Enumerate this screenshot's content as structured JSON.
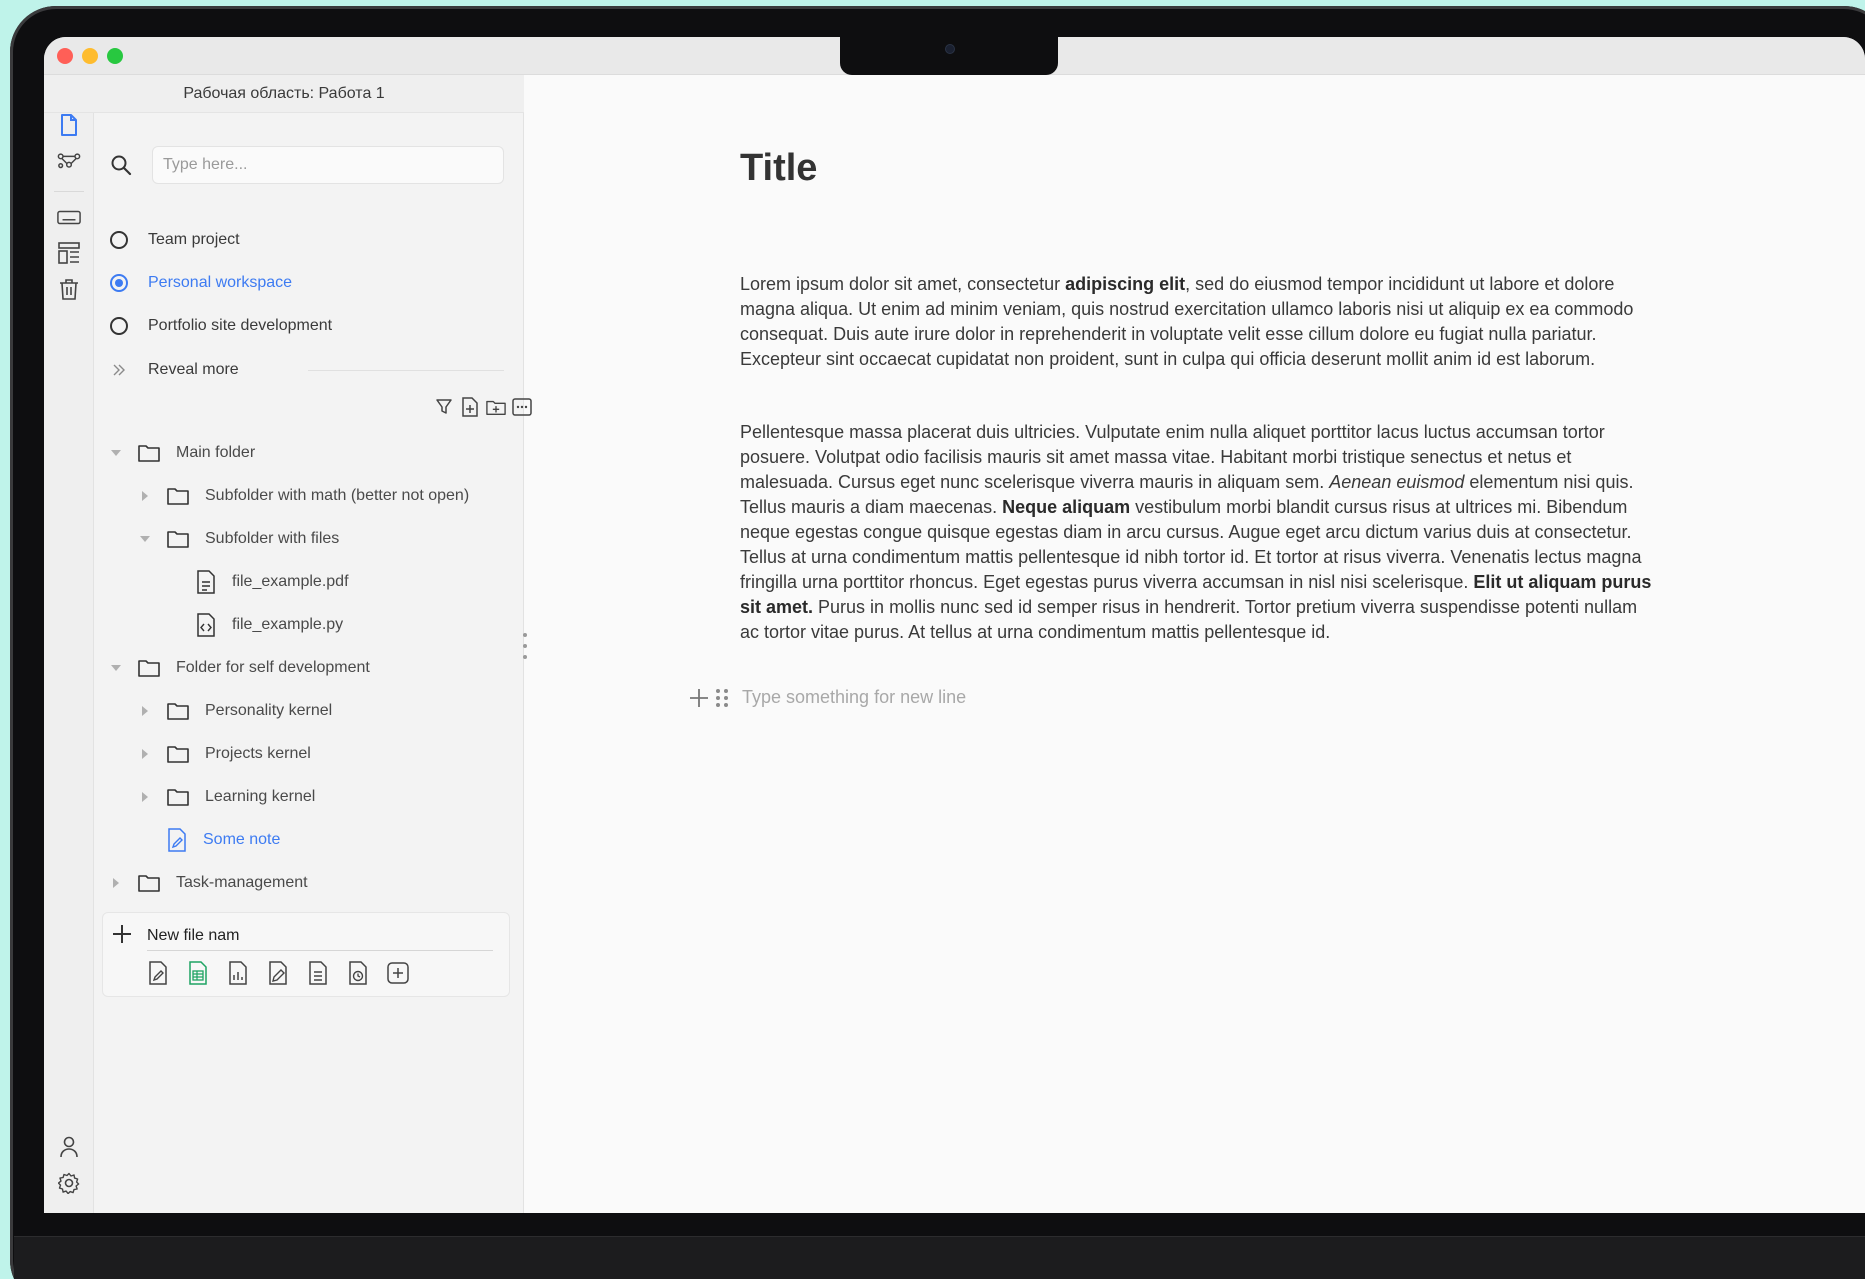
{
  "workspace": {
    "title": "Рабочая область: Работа 1"
  },
  "search": {
    "placeholder": "Type here..."
  },
  "workspaces": [
    {
      "label": "Team project",
      "selected": false
    },
    {
      "label": "Personal workspace",
      "selected": true
    },
    {
      "label": "Portfolio site development",
      "selected": false
    }
  ],
  "reveal_more": "Reveal more",
  "tree": {
    "main_folder": "Main folder",
    "sub_math": "Subfolder with math (better not open)",
    "sub_files": "Subfolder with files",
    "file_pdf": "file_example.pdf",
    "file_py": "file_example.py",
    "self_dev": "Folder for self development",
    "personality": "Personality kernel",
    "projects": "Projects kernel",
    "learning": "Learning kernel",
    "note": "Some note",
    "task_mgmt": "Task-management"
  },
  "new_file": {
    "value": "New file nam"
  },
  "editor": {
    "title": "Title",
    "p1": [
      {
        "t": "Lorem ipsum dolor sit amet, consectetur ",
        "s": "normal"
      },
      {
        "t": "adipiscing elit",
        "s": "bold"
      },
      {
        "t": ", sed do eiusmod tempor incididunt ut labore et dolore magna aliqua. Ut enim ad minim veniam, quis nostrud exercitation ullamco laboris nisi ut aliquip ex ea commodo consequat. Duis aute irure dolor in reprehenderit in voluptate velit esse cillum dolore eu fugiat nulla pariatur. Excepteur sint occaecat cupidatat non proident, sunt in culpa qui officia deserunt mollit anim id est laborum.",
        "s": "normal"
      }
    ],
    "p2": [
      {
        "t": "Pellentesque massa placerat duis ultricies. Vulputate enim nulla aliquet porttitor lacus luctus accumsan tortor posuere. Volutpat odio facilisis mauris sit amet massa vitae. Habitant morbi tristique senectus et netus et malesuada. Cursus eget nunc scelerisque viverra mauris in aliquam sem. ",
        "s": "normal"
      },
      {
        "t": "Aenean euismod",
        "s": "italic"
      },
      {
        "t": " elementum nisi quis. Tellus mauris a diam maecenas. ",
        "s": "normal"
      },
      {
        "t": "Neque aliquam",
        "s": "bold"
      },
      {
        "t": " vestibulum morbi blandit cursus risus at ultrices mi. Bibendum neque egestas congue quisque egestas diam in arcu cursus. Augue eget arcu dictum varius duis at consectetur. Tellus at urna condimentum mattis pellentesque id nibh tortor id. Et tortor at risus viverra. Venenatis lectus magna fringilla urna porttitor rhoncus. Eget egestas purus viverra accumsan in nisl nisi scelerisque. ",
        "s": "normal"
      },
      {
        "t": "Elit ut aliquam purus sit amet.",
        "s": "bold"
      },
      {
        "t": " Purus in mollis nunc sed id semper risus in hendrerit. Tortor pretium viverra suspendisse potenti nullam ac tortor vitae purus. At tellus at urna condimentum mattis pellentesque id.",
        "s": "normal"
      }
    ],
    "newline_placeholder": "Type something for new line"
  },
  "colors": {
    "accent": "#3d7bf2",
    "spreadsheet_green": "#1fa463"
  }
}
